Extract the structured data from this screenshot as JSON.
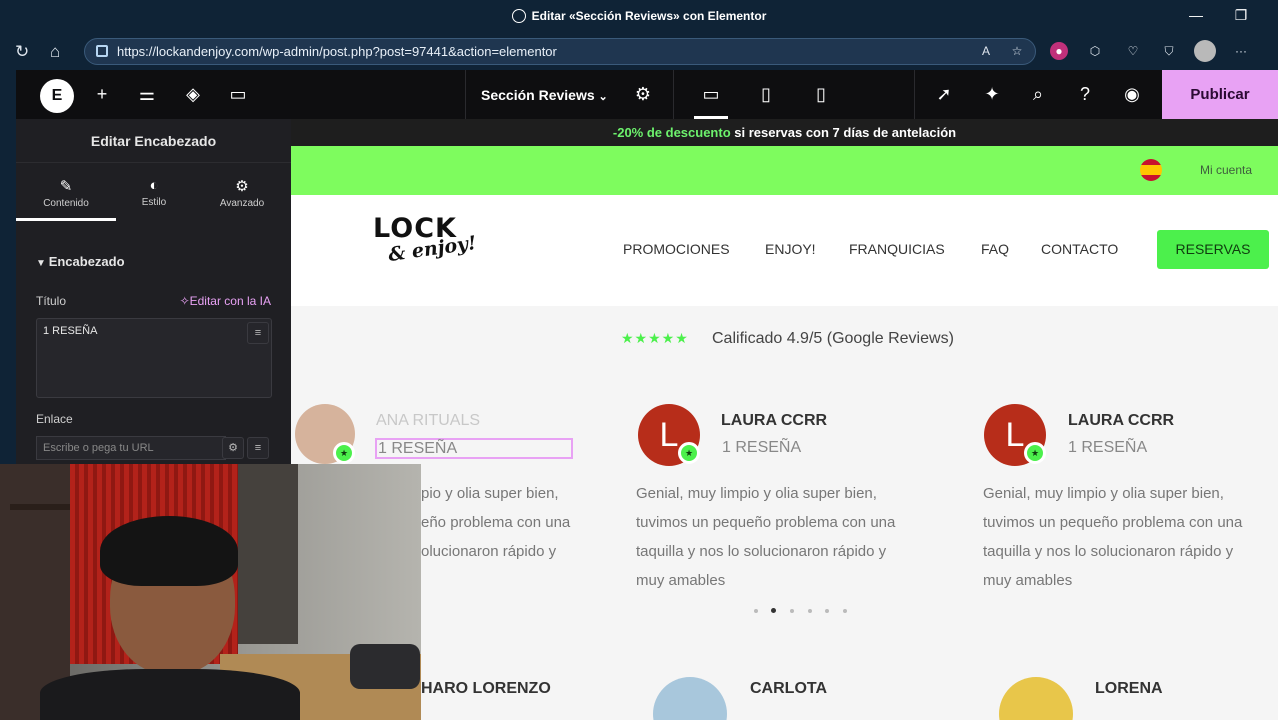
{
  "browser": {
    "window_title": "Editar «Sección Reviews» con Elementor",
    "url": "https://lockandenjoy.com/wp-admin/post.php?post=97441&action=elementor"
  },
  "elementor": {
    "document_title": "Sección Reviews",
    "publish_label": "Publicar",
    "panel": {
      "header": "Editar Encabezado",
      "tabs": [
        {
          "label": "Contenido",
          "icon": "pencil-icon"
        },
        {
          "label": "Estilo",
          "icon": "half-circle-icon"
        },
        {
          "label": "Avanzado",
          "icon": "gear-icon"
        }
      ],
      "section_label": "Encabezado",
      "title_label": "Título",
      "ai_label": "Editar con la IA",
      "title_value": "1 RESEÑA",
      "link_label": "Enlace",
      "link_placeholder": "Escribe o pega tu URL"
    }
  },
  "site": {
    "promo": {
      "highlight": "-20% de descuento",
      "rest": " si reservas con 7 días de antelación"
    },
    "account_label": "Mi cuenta",
    "logo_top": "LOCK",
    "logo_bottom": "& enjoy!",
    "nav": [
      "PROMOCIONES",
      "ENJOY!",
      "FRANQUICIAS",
      "FAQ",
      "CONTACTO"
    ],
    "cta": "RESERVAS",
    "stars": "★★★★★",
    "rating_text": "Calificado 4.9/5 (Google Reviews)",
    "reviews": [
      {
        "name": "ANA RITUALS",
        "sub": "1 RESEÑA",
        "lines": [
          "pio y olia super bien,",
          "eño problema con una",
          "olucionaron rápido y"
        ]
      },
      {
        "name": "LAURA CCRR",
        "sub": "1 RESEÑA",
        "initial": "L",
        "lines": [
          "Genial, muy limpio y olia super bien,",
          "tuvimos un pequeño problema con una",
          "taquilla y nos lo solucionaron rápido y",
          "muy amables"
        ]
      },
      {
        "name": "LAURA CCRR",
        "sub": "1 RESEÑA",
        "initial": "L",
        "lines": [
          "Genial, muy limpio y olia super bien,",
          "tuvimos un pequeño problema con una",
          "taquilla y nos lo solucionaron rápido y",
          "muy amables"
        ]
      }
    ],
    "bottom_names": [
      "HARO LORENZO",
      "CARLOTA",
      "LORENA"
    ],
    "carousel_active": 2
  },
  "colors": {
    "accent": "#e8a2f4",
    "brand_green": "#7efc5e",
    "cta_green": "#4cf04c",
    "avatar_red": "#b72d1a"
  }
}
